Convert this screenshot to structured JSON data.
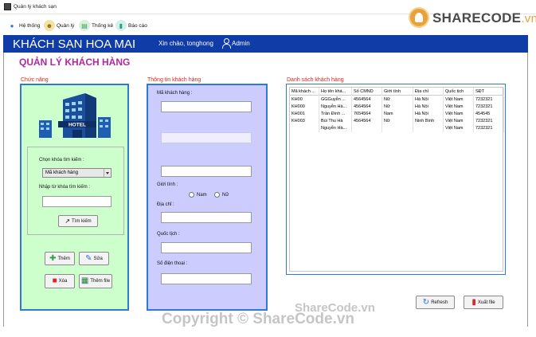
{
  "window": {
    "title": "Quản lý khách sạn"
  },
  "menu": [
    {
      "label": "Hệ thống",
      "icon": "users-icon",
      "color": "#2a7fd4"
    },
    {
      "label": "Quản lý",
      "icon": "manager-icon",
      "color": "#c9a23a"
    },
    {
      "label": "Thống kê",
      "icon": "chart-icon",
      "color": "#3aa05a"
    },
    {
      "label": "Báo cáo",
      "icon": "report-icon",
      "color": "#2aa085"
    }
  ],
  "logo": {
    "brand": "SHARECODE",
    "suffix": ".vn"
  },
  "header": {
    "hotel_name": "KHÁCH SẠN HOA MAI",
    "greeting": "Xin chào, tonghong",
    "role": "Admin"
  },
  "page_title": "QUẢN LÝ KHÁCH HÀNG",
  "left_panel": {
    "title": "Chức năng",
    "search_key_label": "Chọn khóa tìm kiếm :",
    "search_key_value": "Mã khách hàng",
    "search_input_label": "Nhập từ khóa tìm kiếm :",
    "search_button": "Tìm kiếm",
    "add_button": "Thêm",
    "edit_button": "Sửa",
    "delete_button": "Xóa",
    "add_file_button": "Thêm file"
  },
  "form": {
    "title": "Thông tin khách hàng",
    "customer_id_label": "Mã khách hàng :",
    "gender_label": "Giới tính :",
    "gender_male": "Nam",
    "gender_female": "Nữ",
    "address_label": "Địa chỉ :",
    "nationality_label": "Quốc tịch :",
    "phone_label": "Số điện thoại :"
  },
  "list": {
    "title": "Danh sách khách hàng",
    "columns": [
      "Mã khách ...",
      "Họ tên khá...",
      "Số CMND",
      "Giới tính",
      "Địa chỉ",
      "Quốc tịch",
      "SĐT"
    ],
    "rows": [
      [
        "KH00",
        "GGGuyễn ...",
        "4564564",
        "Nữ",
        "Hà Nội",
        "Việt Nam",
        "7232321"
      ],
      [
        "KH000",
        "Nguyễn Hà...",
        "4564564",
        "Nữ",
        "Hà Nội",
        "Việt Nam",
        "7232321"
      ],
      [
        "KH001",
        "Trần Đình ...",
        "7654564",
        "Nam",
        "Hà Nội",
        "Việt Nam",
        "454545"
      ],
      [
        "KH003",
        "Bùi Thu Hà",
        "4564564",
        "Nữ",
        "Ninh Bình",
        "Việt Nam",
        "7232321"
      ],
      [
        "",
        "Nguyễn Hà...",
        "",
        "",
        "",
        "Việt Nam",
        "7232321"
      ]
    ],
    "refresh_button": "Refresh",
    "export_button": "Xuất file"
  },
  "watermark": {
    "top": "ShareCode.vn",
    "bottom": "Copyright © ShareCode.vn"
  }
}
